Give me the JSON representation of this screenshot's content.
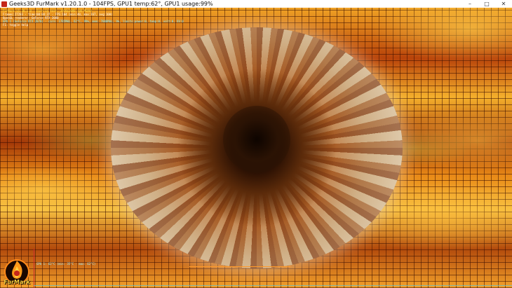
{
  "window": {
    "title": "Geeks3D FurMark v1.20.1.0 - 104FPS, GPU1 temp:62°, GPU1 usage:99%",
    "controls": {
      "minimize": "–",
      "maximize": "□",
      "close": "✕"
    }
  },
  "hud": {
    "title": "FurMark v1.20.1.0 - Burn-in test, 1920x1080 (0X MSAA)",
    "frames": "Frames:27283 - time:00:04:37 - FPS:104 (min:40, max:167, avg:100)",
    "renderer": "OpenGL renderer: GeForce RTX 2080",
    "gpu1": "GPU 1 (GeForce RTX 2070) - core: 1785MHz, 62°C, 99%, mem: 7000MHz, 9%, limits:power:0, temp:0, volt:0, OV:0",
    "help": "F1: toggle help"
  },
  "graph": {
    "label": "GPU 1: 62°C (min: 35°C - max: 62°C)"
  },
  "logo": {
    "text": "FurMark"
  },
  "colors": {
    "hud_title": "#ffe14a",
    "hud_line": "#7de8ff",
    "graph_line": "#ff9a2a",
    "logo_text": "#ffd040"
  }
}
